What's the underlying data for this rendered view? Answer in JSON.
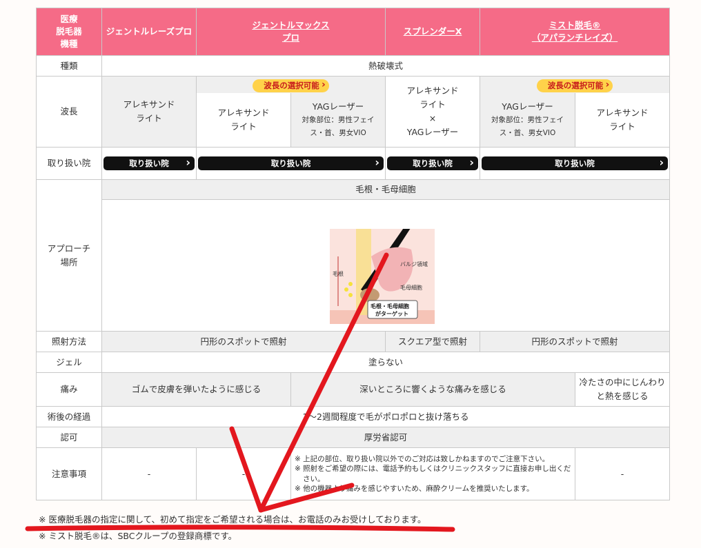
{
  "header": {
    "corner": [
      "医療",
      "脱毛器",
      "機種"
    ],
    "col1": "ジェントルレーズプロ",
    "col2": [
      "ジェントルマックス",
      "プロ"
    ],
    "col3": "スプレンダーX",
    "col4": [
      "ミスト脱毛®",
      "（アパランチレイズ）"
    ]
  },
  "rows": {
    "kind": {
      "label": "種類",
      "value": "熱破壊式"
    },
    "wave": {
      "label": "波長",
      "pill": "波長の選択可能",
      "c1": [
        "アレキサンド",
        "ライト"
      ],
      "c2a": [
        "アレキサンド",
        "ライト"
      ],
      "c2b": "YAGレーザー",
      "c2b_note": [
        "対象部位：男性フェイ",
        "ス・首、男女VIO"
      ],
      "c3": [
        "アレキサンド",
        "ライト",
        "×",
        "YAGレーザー"
      ],
      "c4a": "YAGレーザー",
      "c4a_note": [
        "対象部位：男性フェイ",
        "ス・首、男女VIO"
      ],
      "c4b": [
        "アレキサンド",
        "ライト"
      ]
    },
    "clinic": {
      "label": "取り扱い院",
      "button": "取り扱い院"
    },
    "approach": {
      "label": [
        "アプローチ",
        "場所"
      ],
      "value": "毛根・毛母細胞",
      "img_text": {
        "side": "毛根",
        "bulge": "バルジ領域",
        "matrix": "毛母細胞",
        "target": [
          "毛根・毛母細胞",
          "がターゲット"
        ]
      }
    },
    "method": {
      "label": "照射方法",
      "a": "円形のスポットで照射",
      "b": "スクエア型で照射",
      "c": "円形のスポットで照射"
    },
    "gel": {
      "label": "ジェル",
      "value": "塗らない"
    },
    "pain": {
      "label": "痛み",
      "a": "ゴムで皮膚を弾いたように感じる",
      "b": "深いところに響くような痛みを感じる",
      "c": [
        "冷たさの中にじんわり",
        "と熱を感じる"
      ]
    },
    "after": {
      "label": "術後の経過",
      "value": "1〜2週間程度で毛がポロポロと抜け落ちる"
    },
    "cert": {
      "label": "認可",
      "value": "厚労省認可"
    },
    "caution": {
      "label": "注意事項",
      "dash": "-",
      "notes": [
        "※ 上記の部位、取り扱い院以外でのご対応は致しかねますのでご注意下さい。",
        "※ 照射をご希望の際には、電話予約もしくはクリニックスタッフに直接お申し出ください。",
        "※ 他の機器より痛みを感じやすいため、麻酔クリームを推奨いたします。"
      ]
    }
  },
  "footnotes": [
    "※ 医療脱毛器の指定に関して、初めて指定をご希望される場合は、お電話のみお受けしております。",
    "※ ミスト脱毛®は、SBCクループの登録商標です。"
  ],
  "colors": {
    "header": "#f56b87",
    "pill": "#ffd24a",
    "annotation": "#e3171e"
  }
}
